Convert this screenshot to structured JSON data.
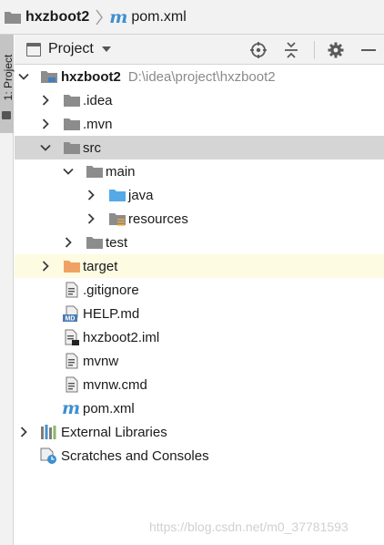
{
  "breadcrumb": {
    "project": "hxzboot2",
    "file_letter": "m",
    "file": "pom.xml"
  },
  "side_strip": {
    "tab_label": "1: Project"
  },
  "panel": {
    "title": "Project",
    "icons": [
      "locate-icon",
      "collapse-all-icon",
      "gear-icon",
      "minimize-icon"
    ]
  },
  "tree": {
    "root_name": "hxzboot2",
    "root_path": "D:\\idea\\project\\hxzboot2",
    "idea": ".idea",
    "mvn": ".mvn",
    "src": "src",
    "main": "main",
    "java": "java",
    "resources": "resources",
    "test": "test",
    "target": "target",
    "gitignore": ".gitignore",
    "help_md": "HELP.md",
    "md_badge": "MD",
    "iml": "hxzboot2.iml",
    "mvnw": "mvnw",
    "mvnw_cmd": "mvnw.cmd",
    "pom_letter": "m",
    "pom": "pom.xml",
    "external_libraries": "External Libraries",
    "scratches": "Scratches and Consoles"
  },
  "colors": {
    "folder_gray": "#8c8c8c",
    "folder_blue": "#55a9e6",
    "folder_orange": "#f0a264",
    "maven_blue": "#3d8fd1",
    "selection": "#d5d5d5",
    "excluded_bg": "#fdfbe2"
  },
  "watermark": "https://blog.csdn.net/m0_37781593"
}
